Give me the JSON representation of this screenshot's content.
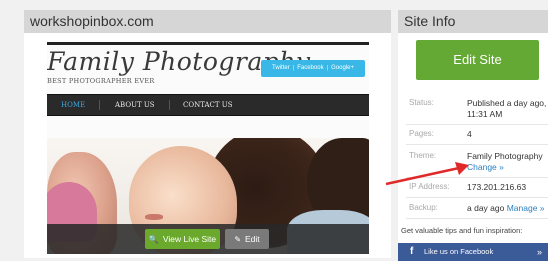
{
  "site": {
    "domain": "workshopinbox.com",
    "preview": {
      "brand_title": "Family Photography",
      "brand_tagline": "BEST PHOTOGRAPHER EVER",
      "social": {
        "twitter": "Twitter",
        "facebook": "Facebook",
        "google": "Google+"
      },
      "nav": [
        "HOME",
        "ABOUT US",
        "CONTACT US"
      ],
      "view_live_label": "View Live Site",
      "edit_label": "Edit"
    }
  },
  "info": {
    "title": "Site Info",
    "edit_site_label": "Edit Site",
    "status_label": "Status:",
    "status_value": "Published a day ago, 11:31 AM",
    "pages_label": "Pages:",
    "pages_value": "4",
    "theme_label": "Theme:",
    "theme_value": "Family Photography",
    "theme_change": "Change »",
    "ip_label": "IP Address:",
    "ip_value": "173.201.216.63",
    "backup_label": "Backup:",
    "backup_value": "a day ago",
    "backup_manage": "Manage »",
    "tips": "Get valuable tips and fun inspiration:",
    "facebook_label": "Like us on Facebook",
    "facebook_icon": "f",
    "facebook_arrow": "»"
  },
  "colors": {
    "accent_green": "#64a933",
    "link_blue": "#2a7fc0",
    "facebook_blue": "#3b5a98",
    "annotation_red": "#e02a2a"
  }
}
